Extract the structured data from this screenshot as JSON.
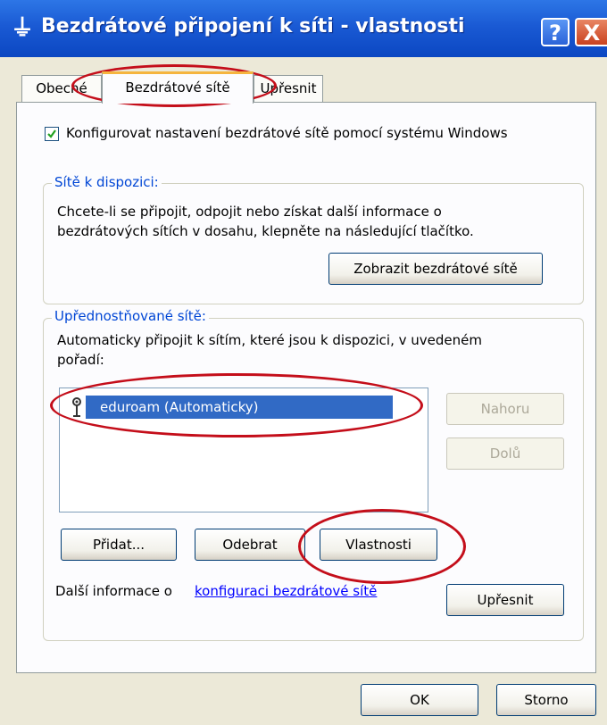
{
  "window": {
    "title": "Bezdrátové připojení k síti - vlastnosti",
    "help": "?",
    "close": "X"
  },
  "tabs": [
    {
      "label": "Obecné"
    },
    {
      "label": "Bezdrátové sítě"
    },
    {
      "label": "Upřesnit"
    }
  ],
  "config": {
    "checkbox_label": "Konfigurovat nastavení bezdrátové sítě pomocí systému Windows",
    "checked": true
  },
  "available": {
    "legend": "Sítě k dispozici:",
    "line1": "Chcete-li se připojit, odpojit nebo získat další informace o",
    "line2": "bezdrátových sítích v dosahu, klepněte na následující tlačítko.",
    "view_button": "Zobrazit bezdrátové sítě"
  },
  "preferred": {
    "legend": "Upřednostňované sítě:",
    "line1": "Automaticky připojit k sítím, které jsou k dispozici, v uvedeném",
    "line2": "pořadí:",
    "networks": [
      {
        "name": "eduroam (Automaticky)",
        "icon": "wireless-network-icon"
      }
    ],
    "up_button": "Nahoru",
    "down_button": "Dolů",
    "add_button": "Přidat...",
    "remove_button": "Odebrat",
    "properties_button": "Vlastnosti"
  },
  "footer": {
    "info_prefix": "Další informace o ",
    "info_link": "konfiguraci bezdrátové sítě",
    "advanced_button": "Upřesnit"
  },
  "dialog": {
    "ok": "OK",
    "cancel": "Storno"
  },
  "colors": {
    "titlebar": "#0b47c2",
    "selection": "#316ac5",
    "highlight_ellipse": "#c40e1a",
    "tab_accent": "#f5b53f"
  }
}
